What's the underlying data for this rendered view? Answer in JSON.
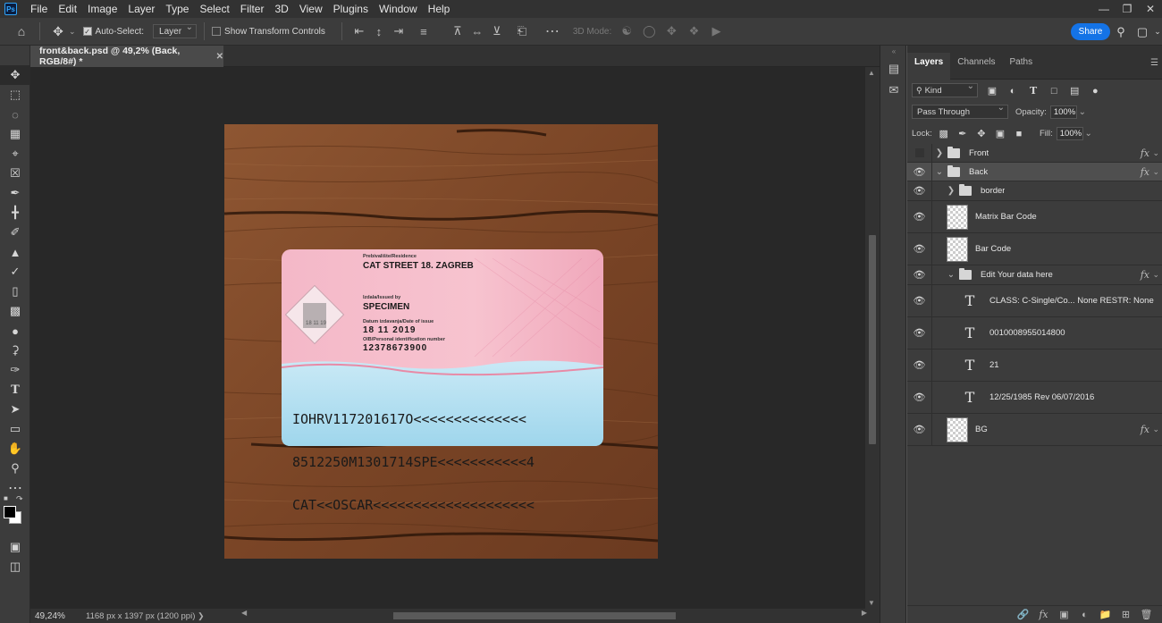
{
  "app": {
    "logo": "Ps"
  },
  "menu": [
    "File",
    "Edit",
    "Image",
    "Layer",
    "Type",
    "Select",
    "Filter",
    "3D",
    "View",
    "Plugins",
    "Window",
    "Help"
  ],
  "options": {
    "auto_select_label": "Auto-Select:",
    "auto_select_checked": true,
    "auto_select_target": "Layer",
    "show_transform_label": "Show Transform Controls",
    "show_transform_checked": false,
    "mode_3d_label": "3D Mode:",
    "share_label": "Share"
  },
  "document": {
    "tab_title": "front&back.psd @ 49,2% (Back, RGB/8#) *",
    "zoom": "49,24%",
    "size_info": "1168 px x 1397 px (1200 ppi)"
  },
  "id_card": {
    "residence_label": "Prebivalište/Residence",
    "residence_value": "CAT STREET 18. ZAGREB",
    "issued_label": "Izdala/Issued by",
    "issued_value": "SPECIMEN",
    "date_label": "Datum izdavanja/Date of issue",
    "date_value": "18 11 2019",
    "oib_label": "OIB/Personal identification number",
    "oib_value": "12378673900",
    "hologram_text": "18 11 19",
    "mrz_line1": "IOHRV117201617O<<<<<<<<<<<<<<",
    "mrz_line2": "8512250M1301714SPE<<<<<<<<<<<4",
    "mrz_line3": "CAT<<OSCAR<<<<<<<<<<<<<<<<<<<<"
  },
  "panel": {
    "tabs": [
      "Layers",
      "Channels",
      "Paths"
    ],
    "active_tab": "Layers",
    "filter_kind": "Kind",
    "blend_mode": "Pass Through",
    "opacity_label": "Opacity:",
    "opacity_value": "100%",
    "lock_label": "Lock:",
    "fill_label": "Fill:",
    "fill_value": "100%"
  },
  "layers": [
    {
      "name": "Front",
      "type": "folder",
      "visible": false,
      "expanded": false,
      "indent": 0,
      "fx": true,
      "selected": false
    },
    {
      "name": "Back",
      "type": "folder",
      "visible": true,
      "expanded": true,
      "indent": 0,
      "fx": true,
      "selected": true
    },
    {
      "name": "border",
      "type": "folder",
      "visible": true,
      "expanded": false,
      "indent": 1,
      "fx": false,
      "selected": false
    },
    {
      "name": "Matrix Bar Code",
      "type": "image",
      "visible": true,
      "indent": 1,
      "fx": false,
      "selected": false
    },
    {
      "name": "Bar Code",
      "type": "image",
      "visible": true,
      "indent": 1,
      "fx": false,
      "selected": false
    },
    {
      "name": "Edit Your data here",
      "type": "folder",
      "visible": true,
      "expanded": true,
      "indent": 1,
      "fx": true,
      "selected": false
    },
    {
      "name": "CLASS: C-Single/Co... None RESTR: None",
      "type": "text",
      "visible": true,
      "indent": 2,
      "fx": false,
      "selected": false
    },
    {
      "name": "0010008955014800",
      "type": "text",
      "visible": true,
      "indent": 2,
      "fx": false,
      "selected": false
    },
    {
      "name": "21",
      "type": "text",
      "visible": true,
      "indent": 2,
      "fx": false,
      "selected": false
    },
    {
      "name": "12/25/1985 Rev 06/07/2016",
      "type": "text",
      "visible": true,
      "indent": 2,
      "fx": false,
      "selected": false
    },
    {
      "name": "BG",
      "type": "image",
      "visible": true,
      "indent": 1,
      "fx": true,
      "selected": false
    }
  ],
  "colors": {
    "accent": "#1473e6",
    "panel_bg": "#3c3c3c",
    "canvas_bg": "#282828",
    "card_pink": "#f4b6c4",
    "card_blue": "#a9dcf0",
    "wood": "#7c4a2a"
  }
}
